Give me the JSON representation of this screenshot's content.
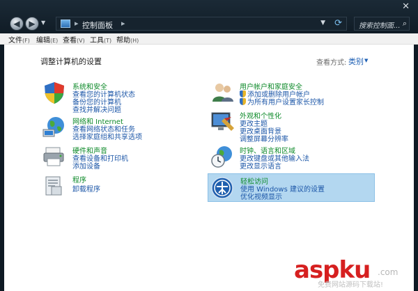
{
  "window": {
    "close_glyph": "✕"
  },
  "nav": {
    "back": "◀",
    "forward": "▶",
    "history_dropdown": "▼"
  },
  "address_bar": {
    "path": "控制面板",
    "separator": "▸",
    "dropdown": "▼",
    "refresh_icon": "refresh-icon"
  },
  "search": {
    "placeholder": "搜索控制面...",
    "icon": "search-icon"
  },
  "menu": {
    "items": [
      {
        "label": "文件",
        "key": "(F)"
      },
      {
        "label": "编辑",
        "key": "(E)"
      },
      {
        "label": "查看",
        "key": "(V)"
      },
      {
        "label": "工具",
        "key": "(T)"
      },
      {
        "label": "帮助",
        "key": "(H)"
      }
    ]
  },
  "content": {
    "title": "调整计算机的设置",
    "view_by_label": "查看方式:",
    "view_by_value": "类别",
    "view_by_caret": "▼"
  },
  "categories": {
    "system": {
      "title": "系统和安全",
      "links": [
        "查看您的计算机状态",
        "备份您的计算机",
        "查找并解决问题"
      ]
    },
    "network": {
      "title": "网络和 Internet",
      "links": [
        "查看网络状态和任务",
        "选择家庭组和共享选项"
      ]
    },
    "hardware": {
      "title": "硬件和声音",
      "links": [
        "查看设备和打印机",
        "添加设备"
      ]
    },
    "programs": {
      "title": "程序",
      "links": [
        "卸载程序"
      ]
    },
    "users": {
      "title": "用户帐户和家庭安全",
      "links": [
        "添加或删除用户帐户",
        "为所有用户设置家长控制"
      ]
    },
    "appearance": {
      "title": "外观和个性化",
      "links": [
        "更改主题",
        "更改桌面背景",
        "调整屏幕分辨率"
      ]
    },
    "clock": {
      "title": "时钟、语言和区域",
      "links": [
        "更改键盘或其他输入法",
        "更改显示语言"
      ]
    },
    "ease": {
      "title": "轻松访问",
      "links": [
        "使用 Windows 建议的设置",
        "优化视频显示"
      ]
    }
  },
  "watermark": {
    "asp": "asp",
    "ku": "ku",
    "dotcn": ".com",
    "subtitle": "免费网站源码下载站!"
  },
  "colors": {
    "chrome": "#101c26",
    "link": "#1d57a8",
    "category_title": "#0e8a2a",
    "highlight": "#b3d7f0"
  }
}
